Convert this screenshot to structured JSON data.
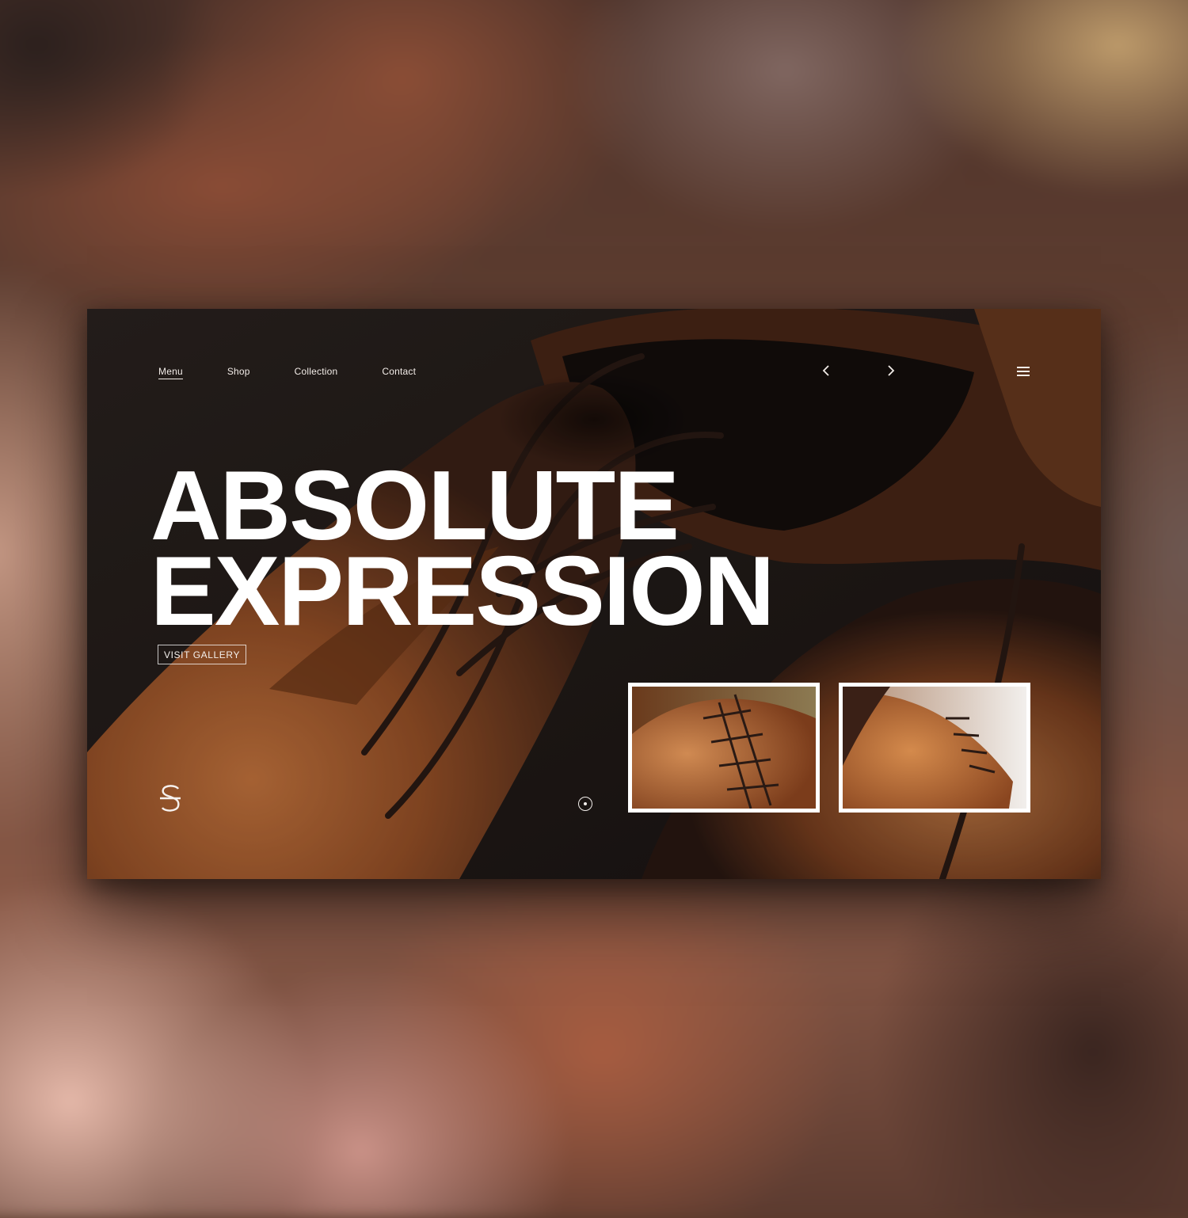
{
  "nav": {
    "items": [
      {
        "label": "Menu",
        "active": true
      },
      {
        "label": "Shop",
        "active": false
      },
      {
        "label": "Collection",
        "active": false
      },
      {
        "label": "Contact",
        "active": false
      }
    ]
  },
  "headline": {
    "line1": "ABSOLUTE",
    "line2": "EXPRESSION"
  },
  "cta": {
    "label": "VISIT GALLERY"
  },
  "icons": {
    "prev": "chevron-left-icon",
    "next": "chevron-right-icon",
    "menu": "hamburger-icon",
    "logo": "s-monogram-logo",
    "indicator": "slide-indicator-icon"
  },
  "colors": {
    "card_background": "#1f1815",
    "leather": "#a35a2c",
    "text": "#ffffff"
  },
  "thumbnails": [
    {
      "alt": "leather shoe close-up with laces"
    },
    {
      "alt": "brogue shoe detail on light background"
    }
  ]
}
